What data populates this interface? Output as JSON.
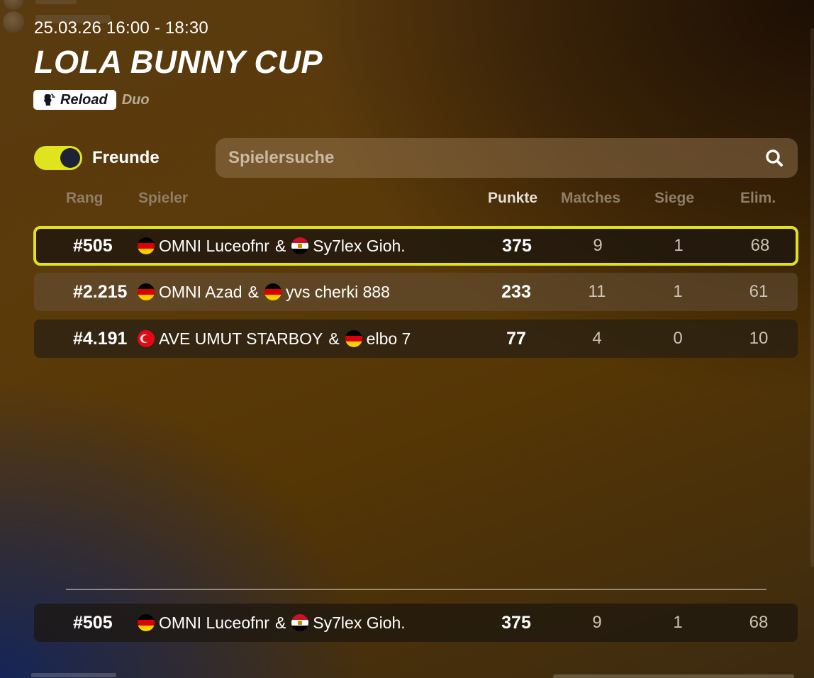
{
  "tournament": {
    "datetime": "25.03.26 16:00 - 18:30",
    "title": "LOLA BUNNY CUP",
    "mode": "Reload",
    "team_size": "Duo"
  },
  "filters": {
    "friends_toggle_label": "Freunde",
    "friends_toggle_on": true,
    "search_placeholder": "Spielersuche"
  },
  "columns": {
    "rank": "Rang",
    "player": "Spieler",
    "points": "Punkte",
    "matches": "Matches",
    "wins": "Siege",
    "elims": "Elim."
  },
  "rows": [
    {
      "rank": "#505",
      "player1": {
        "flag": "de",
        "name": "OMNI Luceofnr"
      },
      "joiner": "&",
      "player2": {
        "flag": "eg",
        "name": "Sy7lex Gioh."
      },
      "points": "375",
      "matches": "9",
      "wins": "1",
      "elims": "68",
      "highlighted": true
    },
    {
      "rank": "#2.215",
      "player1": {
        "flag": "de",
        "name": "OMNI Azad"
      },
      "joiner": "&",
      "player2": {
        "flag": "de",
        "name": "yvs cherki 888"
      },
      "points": "233",
      "matches": "11",
      "wins": "1",
      "elims": "61",
      "highlighted": false
    },
    {
      "rank": "#4.191",
      "player1": {
        "flag": "tr",
        "name": "AVE UMUT STARBOY"
      },
      "joiner": "&",
      "player2": {
        "flag": "de",
        "name": "elbo 7"
      },
      "points": "77",
      "matches": "4",
      "wins": "0",
      "elims": "10",
      "highlighted": false
    }
  ],
  "own_row": {
    "rank": "#505",
    "player1": {
      "flag": "de",
      "name": "OMNI Luceofnr"
    },
    "joiner": "&",
    "player2": {
      "flag": "eg",
      "name": "Sy7lex Gioh."
    },
    "points": "375",
    "matches": "9",
    "wins": "1",
    "elims": "68"
  },
  "colors": {
    "accent": "#e1e21e",
    "toggle_knob": "#1d2236"
  },
  "icons": {
    "mode": "reload-mode-icon",
    "search": "search-icon"
  }
}
